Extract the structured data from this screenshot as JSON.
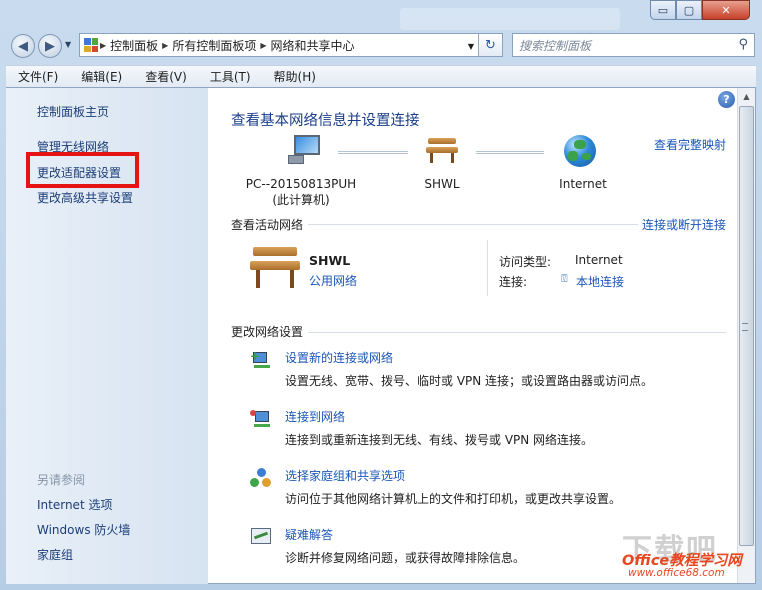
{
  "window": {
    "min_glyph": "▭",
    "max_glyph": "▢",
    "close_glyph": "✕"
  },
  "nav": {
    "back_glyph": "◀",
    "forward_glyph": "▶",
    "breadcrumbs": [
      "控制面板",
      "所有控制面板项",
      "网络和共享中心"
    ],
    "refresh_glyph": "↻",
    "search_placeholder": "搜索控制面板",
    "icons": {
      "control_panel": "control-panel-icon",
      "search": "magnifier-icon"
    }
  },
  "menu": [
    "文件(F)",
    "编辑(E)",
    "查看(V)",
    "工具(T)",
    "帮助(H)"
  ],
  "sidebar": {
    "links": [
      "控制面板主页",
      "管理无线网络",
      "更改适配器设置",
      "更改高级共享设置"
    ],
    "see_also_label": "另请参阅",
    "see_also": [
      "Internet 选项",
      "Windows 防火墙",
      "家庭组"
    ]
  },
  "main": {
    "title": "查看基本网络信息并设置连接",
    "view_full_map": "查看完整映射",
    "map": {
      "computer_name": "PC--20150813PUH",
      "computer_sub": "(此计算机)",
      "network_name": "SHWL",
      "internet": "Internet"
    },
    "active_networks_label": "查看活动网络",
    "connect_disconnect": "连接或断开连接",
    "active_network": {
      "name": "SHWL",
      "type": "公用网络",
      "access_type_label": "访问类型:",
      "access_type_value": "Internet",
      "connection_label": "连接:",
      "connection_value": "本地连接"
    },
    "change_settings_label": "更改网络设置",
    "tasks": [
      {
        "title": "设置新的连接或网络",
        "desc": "设置无线、宽带、拨号、临时或 VPN 连接；或设置路由器或访问点。"
      },
      {
        "title": "连接到网络",
        "desc": "连接到或重新连接到无线、有线、拨号或 VPN 网络连接。"
      },
      {
        "title": "选择家庭组和共享选项",
        "desc": "访问位于其他网络计算机上的文件和打印机，或更改共享设置。"
      },
      {
        "title": "疑难解答",
        "desc": "诊断并修复网络问题，或获得故障排除信息。"
      }
    ],
    "help_glyph": "?"
  },
  "watermark": {
    "big": "下载吧",
    "line1": "Office教程学习网",
    "line2": "www.office68.com"
  },
  "colors": {
    "highlight": "#e51414",
    "link": "#1a56b8"
  }
}
